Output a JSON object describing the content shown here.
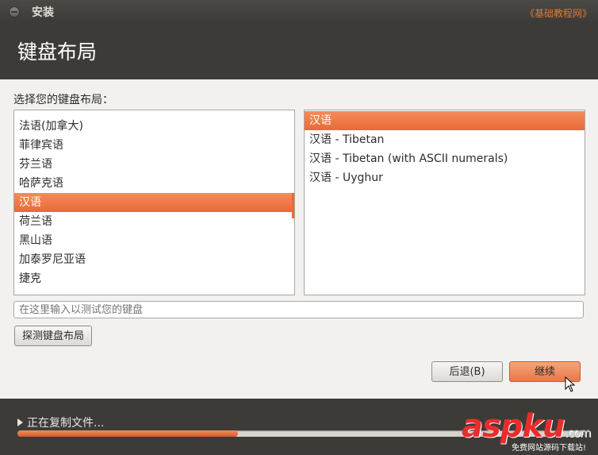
{
  "window": {
    "title": "安装",
    "watermark_top": "《基础教程网》"
  },
  "header": {
    "title": "键盘布局"
  },
  "content": {
    "prompt": "选择您的键盘布局：",
    "left_list": {
      "items": [
        {
          "label": "法语(加拿大)",
          "selected": false
        },
        {
          "label": "菲律宾语",
          "selected": false
        },
        {
          "label": "芬兰语",
          "selected": false
        },
        {
          "label": "哈萨克语",
          "selected": false
        },
        {
          "label": "汉语",
          "selected": true
        },
        {
          "label": "荷兰语",
          "selected": false
        },
        {
          "label": "黑山语",
          "selected": false
        },
        {
          "label": "加泰罗尼亚语",
          "selected": false
        },
        {
          "label": "捷克",
          "selected": false
        }
      ]
    },
    "right_list": {
      "items": [
        {
          "label": "汉语",
          "selected": true
        },
        {
          "label": "汉语 - Tibetan",
          "selected": false
        },
        {
          "label": "汉语 - Tibetan (with ASCII numerals)",
          "selected": false
        },
        {
          "label": "汉语 - Uyghur",
          "selected": false
        }
      ]
    },
    "test_input": {
      "placeholder": "在这里输入以测试您的键盘",
      "value": ""
    },
    "detect_button": "探测键盘布局",
    "back_button": "后退(B)",
    "continue_button": "继续"
  },
  "footer": {
    "progress_label": "正在复制文件...",
    "progress_fraction": 0.39
  },
  "watermark": {
    "logo": "aspku",
    "suffix": ".com",
    "tagline": "免费网站源码下载站!"
  },
  "colors": {
    "accent": "#e86a36",
    "dark_bg": "#3c3b37",
    "panel_bg": "#f2f1f0"
  }
}
